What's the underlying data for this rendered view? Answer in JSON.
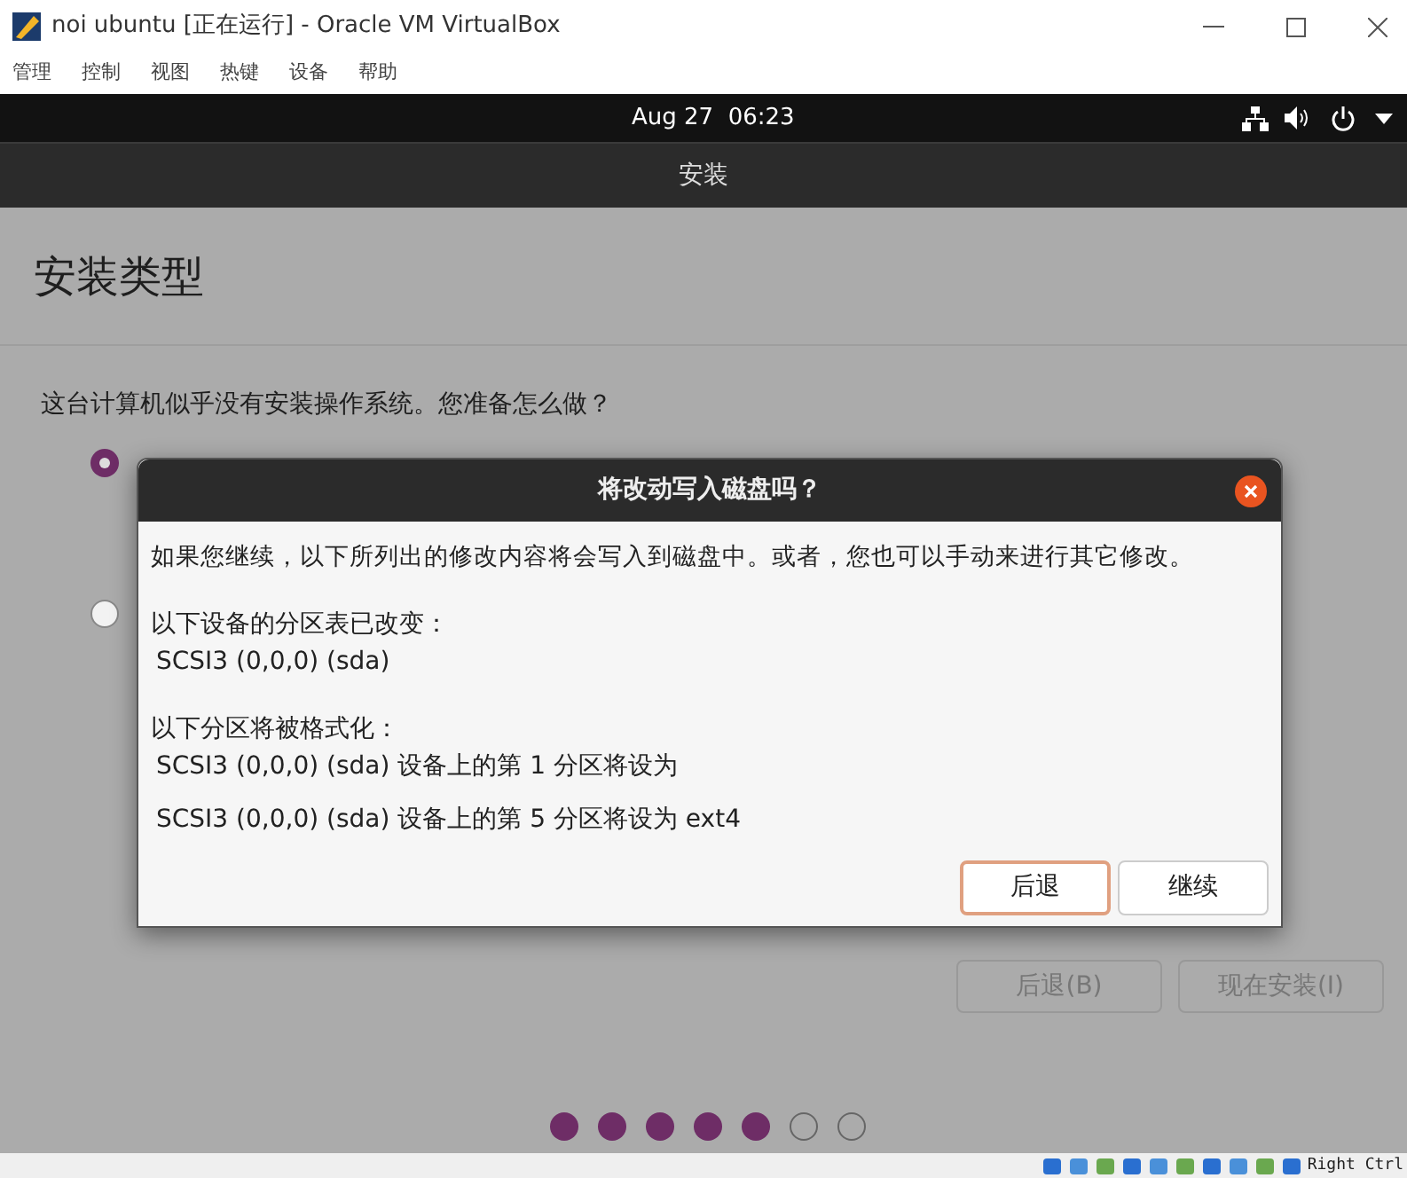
{
  "window": {
    "title": "noi ubuntu [正在运行] - Oracle VM VirtualBox"
  },
  "menu": [
    "管理",
    "控制",
    "视图",
    "热键",
    "设备",
    "帮助"
  ],
  "top_bar": {
    "clock": "Aug 27  06:23"
  },
  "header": {
    "title": "安装"
  },
  "page": {
    "heading": "安装类型",
    "question": "这台计算机似乎没有安装操作系统。您准备怎么做？",
    "options": [
      {
        "selected": true
      },
      {
        "selected": false
      }
    ],
    "buttons": [
      {
        "label": "后退(B)",
        "disabled": true
      },
      {
        "label": "现在安装(I)",
        "disabled": true
      }
    ]
  },
  "steps": [
    {
      "done": true
    },
    {
      "done": true
    },
    {
      "done": true
    },
    {
      "done": true
    },
    {
      "done": true
    },
    {
      "done": false
    },
    {
      "done": false
    }
  ],
  "dialog": {
    "title": "将改动写入磁盘吗？",
    "intro": "如果您继续，以下所列出的修改内容将会写入到磁盘中。或者，您也可以手动来进行其它修改。",
    "sections": [
      {
        "heading": "以下设备的分区表已改变：",
        "lines": [
          "SCSI3 (0,0,0) (sda)"
        ]
      },
      {
        "heading": "以下分区将被格式化：",
        "lines": [
          "SCSI3 (0,0,0) (sda) 设备上的第 1 分区将设为",
          "SCSI3 (0,0,0) (sda) 设备上的第 5 分区将设为 ext4"
        ]
      }
    ],
    "buttons": [
      {
        "label": "后退",
        "focused": true
      },
      {
        "label": "继续",
        "focused": false
      }
    ]
  },
  "status_bar": {
    "host_key": "Right Ctrl"
  }
}
